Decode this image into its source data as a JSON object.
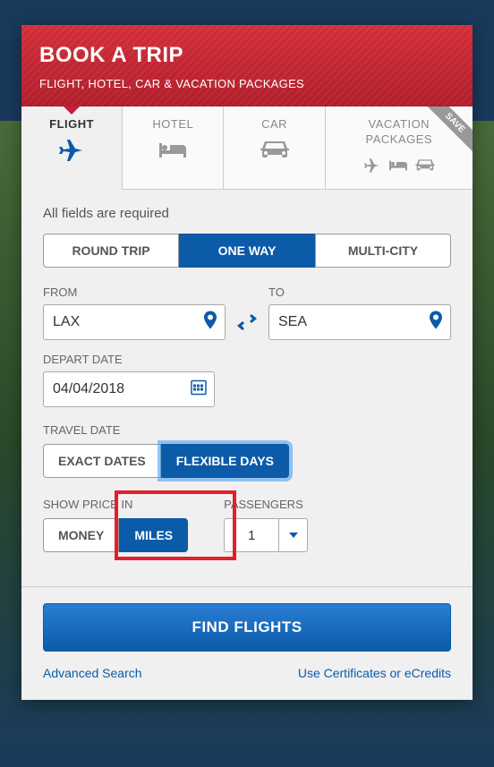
{
  "header": {
    "title": "BOOK A TRIP",
    "subtitle": "FLIGHT, HOTEL, CAR & VACATION PACKAGES"
  },
  "tabs": {
    "flight": "FLIGHT",
    "hotel": "HOTEL",
    "car": "CAR",
    "vacation_line1": "VACATION",
    "vacation_line2": "PACKAGES",
    "save_badge": "SAVE"
  },
  "required_text": "All fields are required",
  "trip_type": {
    "round": "ROUND TRIP",
    "one_way": "ONE WAY",
    "multi": "MULTI-CITY",
    "selected": "one_way"
  },
  "from": {
    "label": "FROM",
    "value": "LAX"
  },
  "to": {
    "label": "TO",
    "value": "SEA"
  },
  "depart": {
    "label": "DEPART DATE",
    "value": "04/04/2018"
  },
  "travel_date": {
    "label": "TRAVEL DATE",
    "exact": "EXACT DATES",
    "flexible": "FLEXIBLE DAYS",
    "selected": "flexible"
  },
  "price_in": {
    "label": "SHOW PRICE IN",
    "money": "MONEY",
    "miles": "MILES",
    "selected": "miles"
  },
  "passengers": {
    "label": "PASSENGERS",
    "value": "1"
  },
  "find_button": "FIND FLIGHTS",
  "links": {
    "advanced": "Advanced Search",
    "ecredits": "Use Certificates or eCredits"
  },
  "colors": {
    "brand_red": "#c41e3a",
    "brand_blue": "#0b5ba8",
    "highlight_red": "#e41e2a"
  }
}
